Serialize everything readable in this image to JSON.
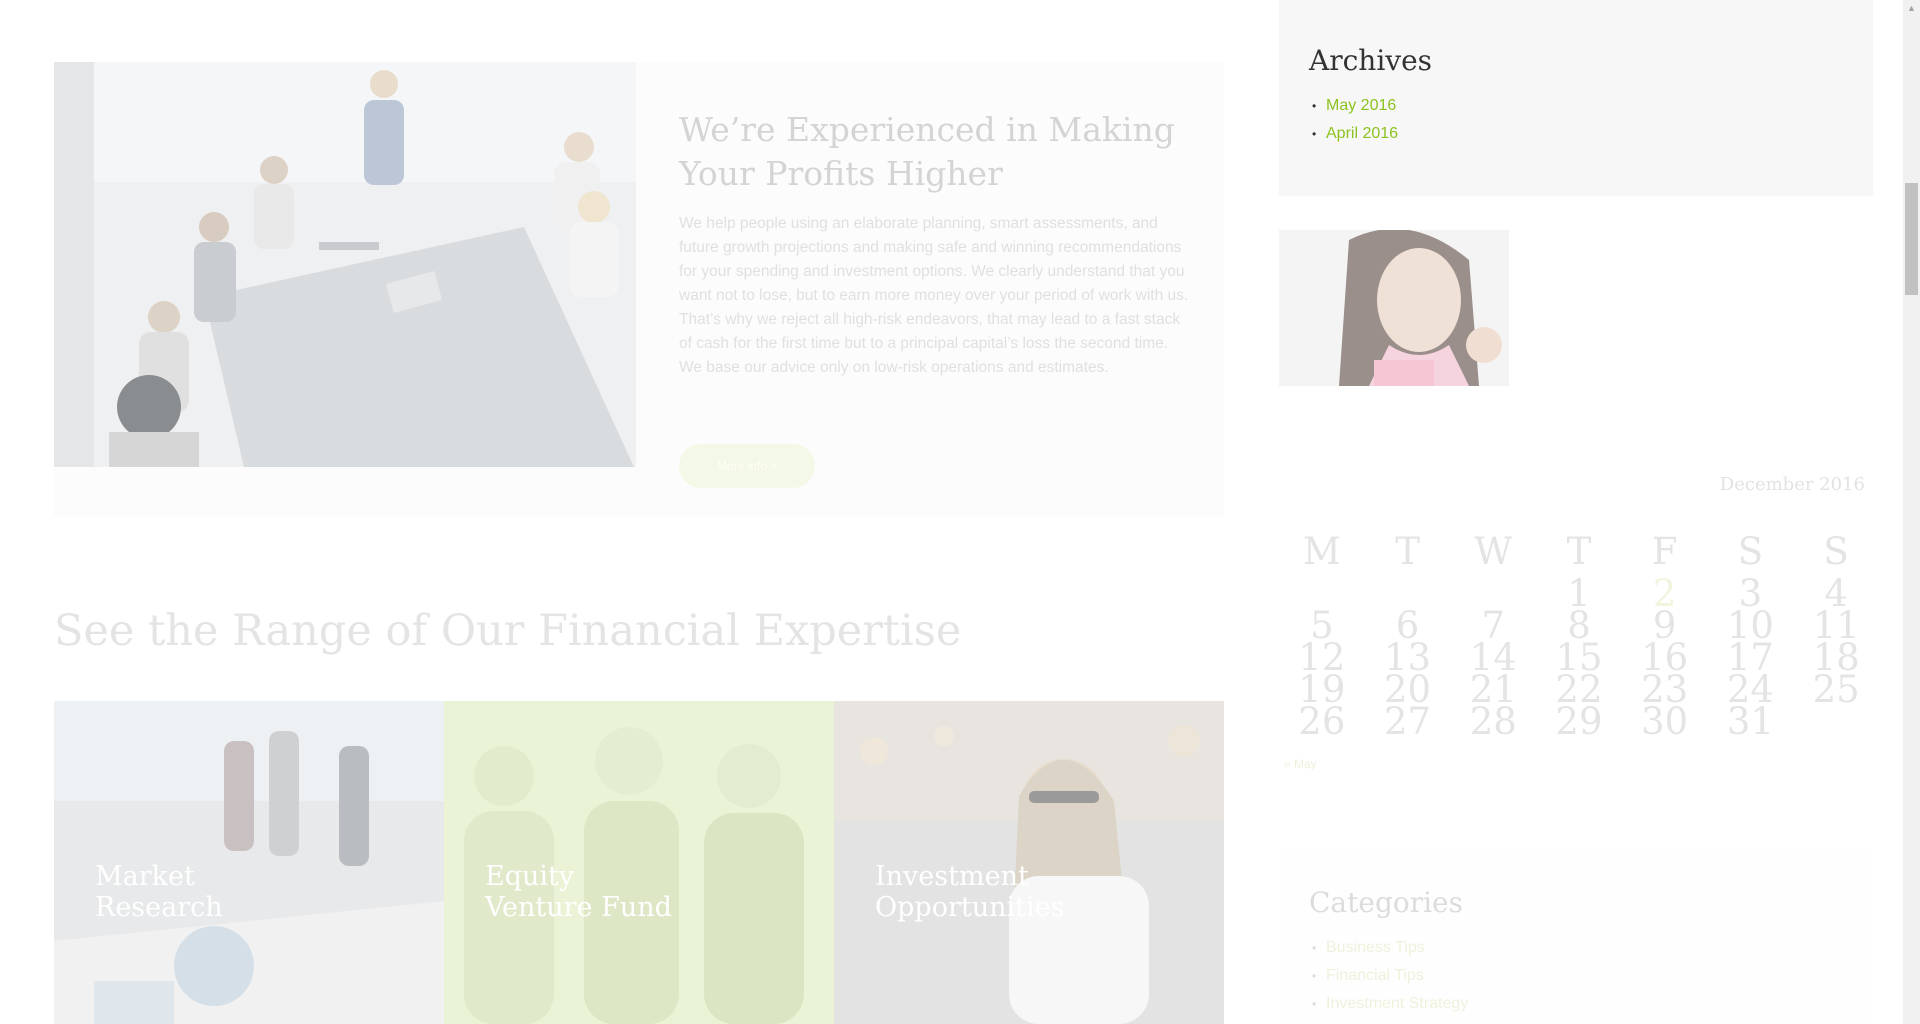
{
  "about": {
    "title": "We’re Experienced in Making Your Profits Higher",
    "text": "We help people using an elaborate planning, smart assessments, and future growth projections and making safe and winning recommendations for your spending and investment options. We clearly understand that you want not to lose, but to earn more money over your period of work with us. That’s why we reject all high-risk endeavors, that may lead to a fast stack of cash for the first time but to a principal capital’s loss the second time. We base our advice only on low-risk operations and estimates.",
    "button_label": "More info »"
  },
  "expertise": {
    "title": "See the Range of Our Financial Expertise",
    "tiles": [
      {
        "line1": "Market",
        "line2": "Research"
      },
      {
        "line1": "Equity",
        "line2": "Venture Fund"
      },
      {
        "line1": "Investment",
        "line2": "Opportunities"
      }
    ]
  },
  "sidebar": {
    "archives": {
      "title": "Archives",
      "items": [
        {
          "label": "May 2016"
        },
        {
          "label": "April 2016"
        }
      ]
    },
    "calendar": {
      "caption": "December 2016",
      "weekdays": [
        "M",
        "T",
        "W",
        "T",
        "F",
        "S",
        "S"
      ],
      "weeks": [
        [
          "",
          "",
          "",
          "1",
          "2",
          "3",
          "4"
        ],
        [
          "5",
          "6",
          "7",
          "8",
          "9",
          "10",
          "11"
        ],
        [
          "12",
          "13",
          "14",
          "15",
          "16",
          "17",
          "18"
        ],
        [
          "19",
          "20",
          "21",
          "22",
          "23",
          "24",
          "25"
        ],
        [
          "26",
          "27",
          "28",
          "29",
          "30",
          "31",
          ""
        ]
      ],
      "today": "2",
      "prev_link": "« May"
    },
    "categories": {
      "title": "Categories",
      "items": [
        {
          "label": "Business Tips"
        },
        {
          "label": "Financial Tips"
        },
        {
          "label": "Investment Strategy"
        }
      ]
    }
  },
  "colors": {
    "accent": "#8cc21f",
    "accent_faded": "#eef2dc",
    "archive_title": "#333333",
    "faded_title": "#dcdcdc",
    "faded_text": "#e0e0e0"
  }
}
